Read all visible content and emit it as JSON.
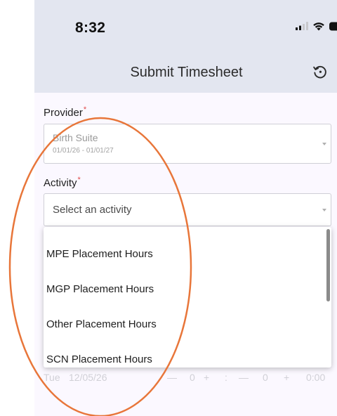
{
  "status_bar": {
    "time": "8:32"
  },
  "header": {
    "title": "Submit Timesheet",
    "history_icon": "history-icon"
  },
  "form": {
    "provider": {
      "label": "Provider",
      "required_mark": "*",
      "value_name": "Birth Suite",
      "value_dates": "01/01/26 - 01/01/27"
    },
    "activity": {
      "label": "Activity",
      "required_mark": "*",
      "placeholder": "Select an activity",
      "options": [
        "MPE Placement Hours",
        "MGP Placement Hours",
        "Other Placement Hours",
        "SCN Placement Hours"
      ]
    },
    "time_entry": {
      "day": "Tue",
      "date": "12/05/26",
      "minus_1": "—",
      "hours": "0",
      "plus_1": "+",
      "separator": ":",
      "minus_2": "—",
      "minutes": "0",
      "plus_2": "+",
      "total": "0:00"
    }
  },
  "annotation": {
    "color": "#e8763a"
  }
}
